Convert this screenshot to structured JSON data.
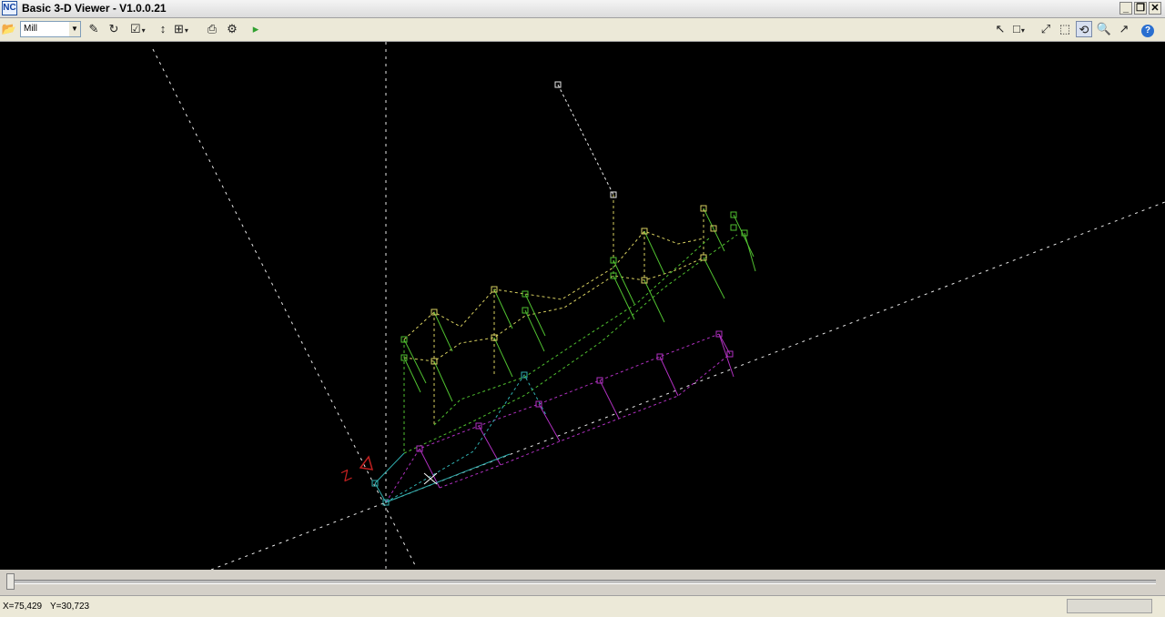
{
  "window": {
    "title": "Basic 3-D Viewer - V1.0.0.21",
    "minimize_glyph": "_",
    "restore_glyph": "❐",
    "close_glyph": "✕"
  },
  "toolbar": {
    "open_glyph": "📂",
    "machine_select": {
      "selected": "Mill"
    },
    "edit_glyph": "✎",
    "refresh_glyph": "↻",
    "list_glyph": "☑",
    "axis_glyph": "↕",
    "grid_glyph": "⊞",
    "print_glyph": "⎙",
    "settings_glyph": "⚙",
    "marker_glyph": "▸",
    "select_glyph": "↖",
    "new_glyph": "□",
    "fit_glyph": "⤢",
    "zoom_window_glyph": "⬚",
    "rotate_glyph": "⟲",
    "zoom_glyph": "🔍",
    "pan_glyph": "↗",
    "help_glyph": "?"
  },
  "viewport": {
    "axis_label": "Z",
    "colors": {
      "background": "#000000",
      "axis": "#e8e8e8",
      "rapid_yellow": "#d8d060",
      "green": "#50c030",
      "cyan": "#30b0b0",
      "magenta": "#b030c0",
      "axis_label": "#c02020"
    }
  },
  "status": {
    "x_coord": "X=75,429",
    "y_coord": "Y=30,723"
  }
}
